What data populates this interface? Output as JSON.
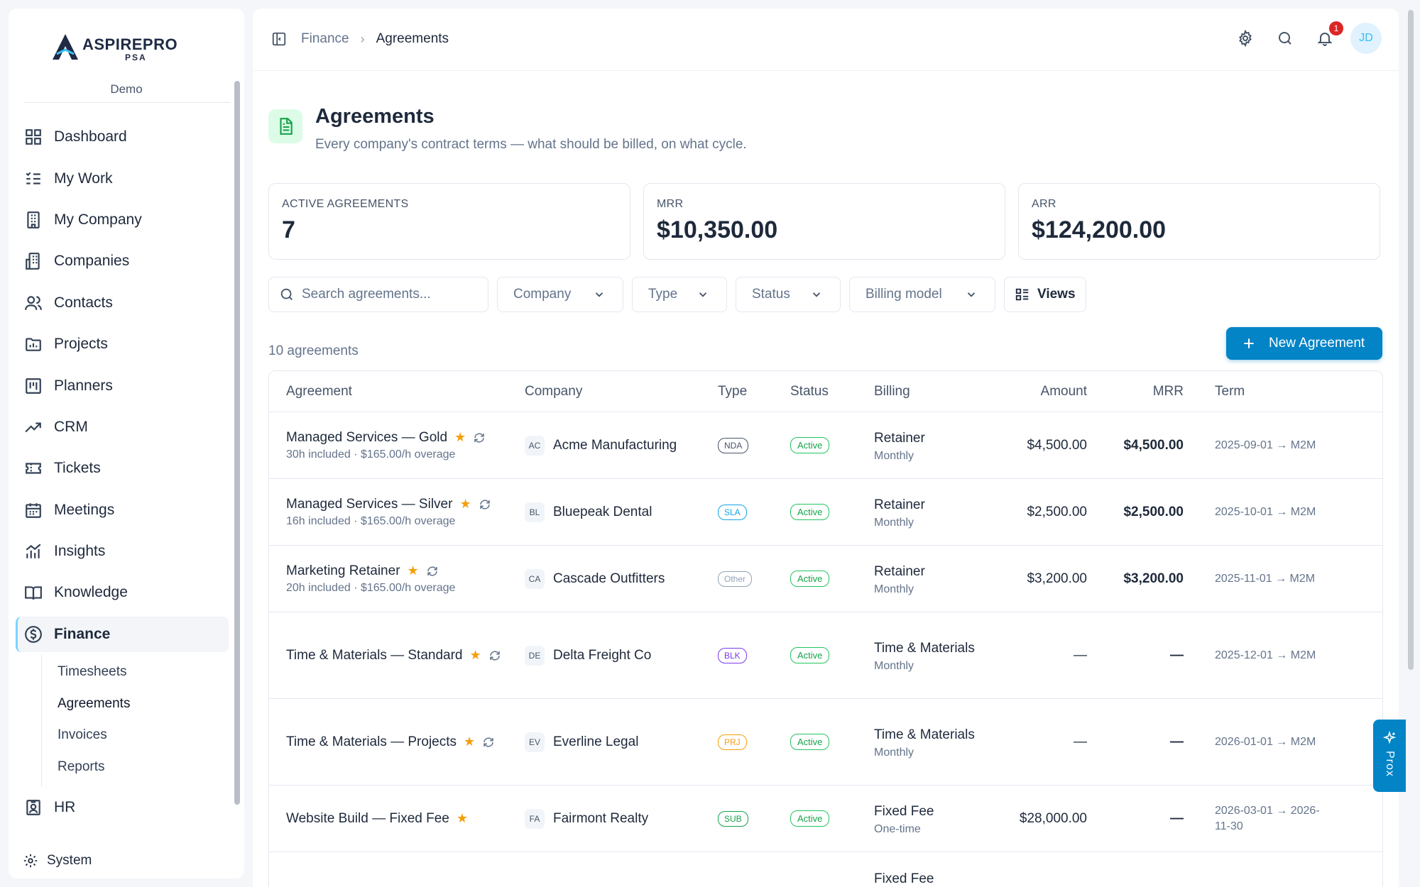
{
  "brand": {
    "name": "ASPIREPRO",
    "sub": "PSA"
  },
  "sidebar": {
    "tenant": "Demo",
    "items": [
      {
        "label": "Dashboard",
        "icon": "dashboard-icon"
      },
      {
        "label": "My Work",
        "icon": "checklist-icon"
      },
      {
        "label": "My Company",
        "icon": "building-icon"
      },
      {
        "label": "Companies",
        "icon": "buildings-icon"
      },
      {
        "label": "Contacts",
        "icon": "users-icon"
      },
      {
        "label": "Projects",
        "icon": "folder-chart-icon"
      },
      {
        "label": "Planners",
        "icon": "kanban-icon"
      },
      {
        "label": "CRM",
        "icon": "trending-up-icon"
      },
      {
        "label": "Tickets",
        "icon": "ticket-icon"
      },
      {
        "label": "Meetings",
        "icon": "calendar-icon"
      },
      {
        "label": "Insights",
        "icon": "bar-chart-icon"
      },
      {
        "label": "Knowledge",
        "icon": "book-icon"
      },
      {
        "label": "Finance",
        "icon": "dollar-circle-icon"
      }
    ],
    "finance_sub": [
      "Timesheets",
      "Agreements",
      "Invoices",
      "Reports"
    ],
    "hr": "HR",
    "system": "System"
  },
  "breadcrumb": {
    "parent": "Finance",
    "current": "Agreements"
  },
  "header": {
    "notifications": "1",
    "avatar": "JD"
  },
  "page": {
    "title": "Agreements",
    "subtitle": "Every company's contract terms — what should be billed, on what cycle."
  },
  "stats": [
    {
      "label": "ACTIVE AGREEMENTS",
      "value": "7"
    },
    {
      "label": "MRR",
      "value": "$10,350.00"
    },
    {
      "label": "ARR",
      "value": "$124,200.00"
    }
  ],
  "filters": {
    "search_placeholder": "Search agreements...",
    "company": "Company",
    "type": "Type",
    "status": "Status",
    "billing": "Billing model",
    "views": "Views"
  },
  "count": "10 agreements",
  "new_button": "New Agreement",
  "table": {
    "headers": [
      "Agreement",
      "Company",
      "Type",
      "Status",
      "Billing",
      "Amount",
      "MRR",
      "Term"
    ],
    "rows": [
      {
        "name": "Managed Services — Gold",
        "detail": "30h included · $165.00/h overage",
        "recurring": true,
        "initials": "AC",
        "company": "Acme Manufacturing",
        "type": "NDA",
        "type_color": "#475569",
        "status": "Active",
        "billing": "Retainer",
        "cycle": "Monthly",
        "amount": "$4,500.00",
        "mrr": "$4,500.00",
        "term": "2025-09-01 → M2M"
      },
      {
        "name": "Managed Services — Silver",
        "detail": "16h included · $165.00/h overage",
        "recurring": true,
        "initials": "BL",
        "company": "Bluepeak Dental",
        "type": "SLA",
        "type_color": "#0ea5e9",
        "status": "Active",
        "billing": "Retainer",
        "cycle": "Monthly",
        "amount": "$2,500.00",
        "mrr": "$2,500.00",
        "term": "2025-10-01 → M2M"
      },
      {
        "name": "Marketing Retainer",
        "detail": "20h included · $165.00/h overage",
        "recurring": true,
        "initials": "CA",
        "company": "Cascade Outfitters",
        "type": "Other",
        "type_color": "#94a3b8",
        "status": "Active",
        "billing": "Retainer",
        "cycle": "Monthly",
        "amount": "$3,200.00",
        "mrr": "$3,200.00",
        "term": "2025-11-01 → M2M"
      },
      {
        "name": "Time & Materials — Standard",
        "detail": "",
        "recurring": true,
        "initials": "DE",
        "company": "Delta Freight Co",
        "type": "BLK",
        "type_color": "#7c3aed",
        "status": "Active",
        "billing": "Time & Materials",
        "cycle": "Monthly",
        "amount": "—",
        "mrr": "—",
        "term": "2025-12-01 → M2M"
      },
      {
        "name": "Time & Materials — Projects",
        "detail": "",
        "recurring": true,
        "initials": "EV",
        "company": "Everline Legal",
        "type": "PRJ",
        "type_color": "#f59e0b",
        "status": "Active",
        "billing": "Time & Materials",
        "cycle": "Monthly",
        "amount": "—",
        "mrr": "—",
        "term": "2026-01-01 → M2M"
      },
      {
        "name": "Website Build — Fixed Fee",
        "detail": "",
        "recurring": false,
        "initials": "FA",
        "company": "Fairmont Realty",
        "type": "SUB",
        "type_color": "#16a34a",
        "status": "Active",
        "billing": "Fixed Fee",
        "cycle": "One-time",
        "amount": "$28,000.00",
        "mrr": "—",
        "term": "2026-03-01 → 2026-11-30"
      },
      {
        "name": "",
        "detail": "",
        "recurring": false,
        "initials": "",
        "company": "",
        "type": "",
        "type_color": "#94a3b8",
        "status": "",
        "billing": "Fixed Fee",
        "cycle": "",
        "amount": "",
        "mrr": "",
        "term": ""
      }
    ]
  },
  "copilot": "Prox",
  "colors": {
    "accent": "#0284c7",
    "active_green": "#16a34a",
    "star": "#f59e0b"
  }
}
